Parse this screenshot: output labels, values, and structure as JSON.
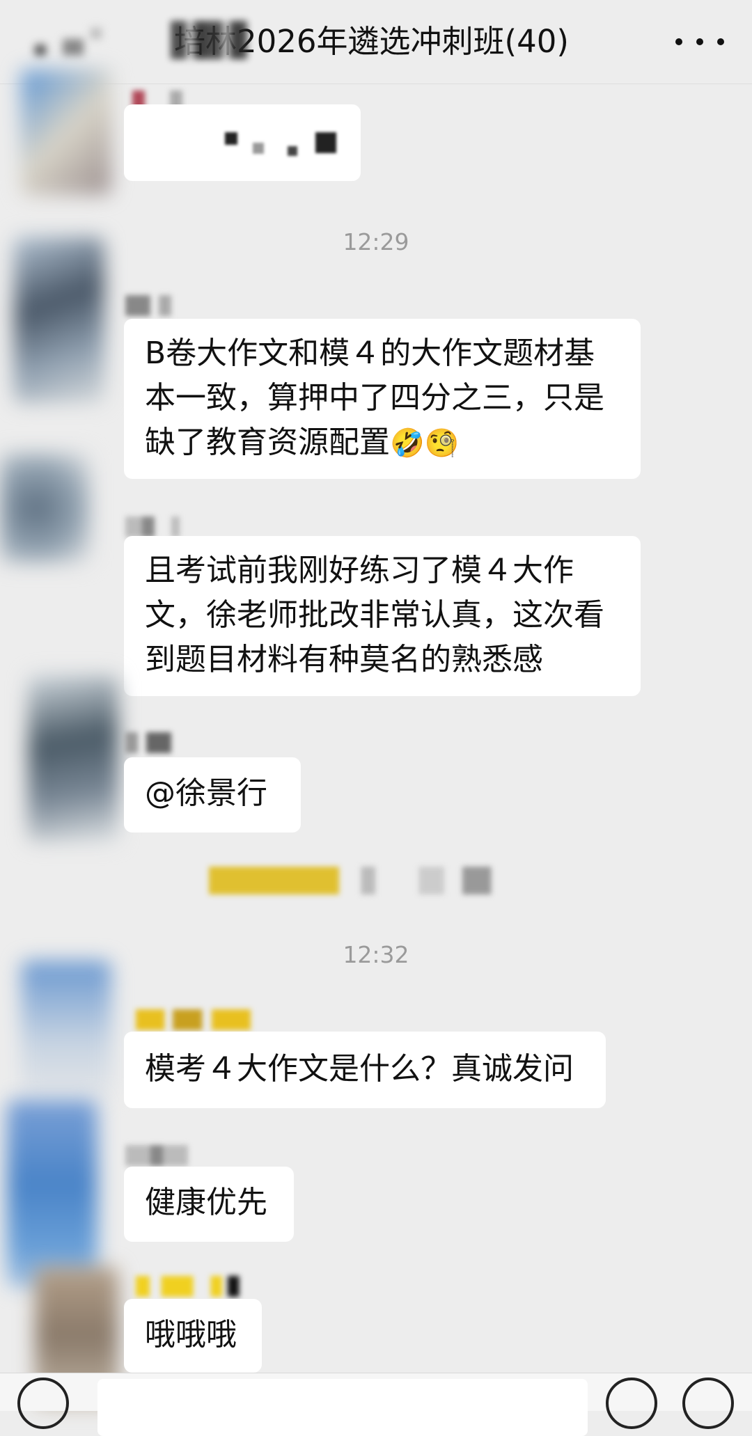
{
  "header": {
    "title": "培林2026年遴选冲刺班(40)",
    "back_icon": "chevron-left-icon",
    "more_icon": "more-dots-icon"
  },
  "timestamps": [
    "12:29",
    "12:32"
  ],
  "messages": [
    {
      "text": "B卷大作文和模４的大作文题材基本一致，算押中了四分之三，只是缺了教育资源配置",
      "emojis": "🤣🧐"
    },
    {
      "text": "且考试前我刚好练习了模４大作文，徐老师批改非常认真，这次看到题目材料有种莫名的熟悉感"
    },
    {
      "text": "@徐景行"
    },
    {
      "text": "模考４大作文是什么？真诚发问"
    },
    {
      "text": "健康优先"
    },
    {
      "text": "哦哦哦"
    }
  ],
  "input_bar": {
    "voice_icon": "voice-icon",
    "emoji_icon": "emoji-icon",
    "plus_icon": "plus-icon"
  }
}
